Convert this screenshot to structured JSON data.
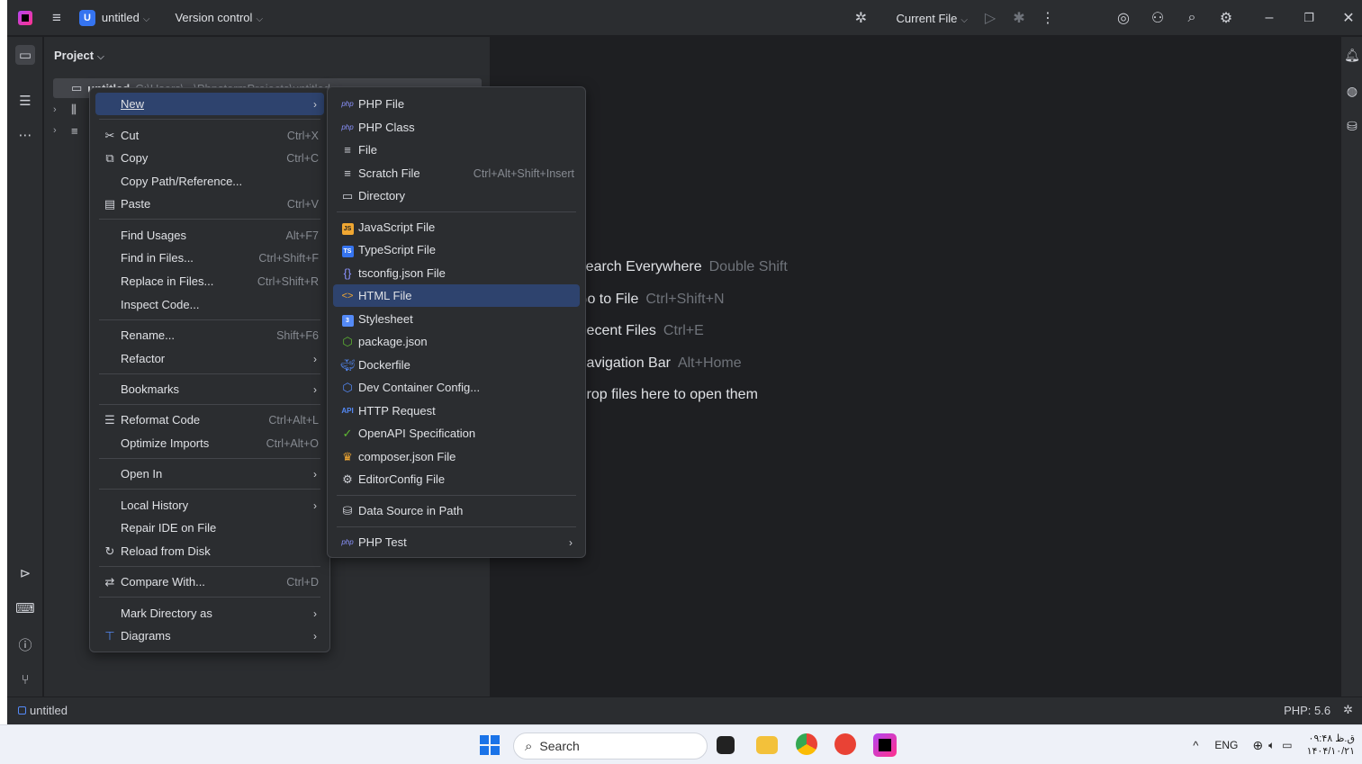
{
  "titlebar": {
    "project_badge": "U",
    "project_name": "untitled",
    "vcs_label": "Version control",
    "run_config": "Current File"
  },
  "panel": {
    "title": "Project",
    "tree_root": "untitled",
    "tree_root_path": "C:\\Users\\...\\PhpstormProjects\\untitled"
  },
  "context_menu": {
    "items": [
      {
        "label": "New",
        "icon": "",
        "shortcut": "",
        "submenu": true
      },
      {
        "label": "Cut",
        "icon": "scissors-icon",
        "shortcut": "Ctrl+X"
      },
      {
        "label": "Copy",
        "icon": "copy-icon",
        "shortcut": "Ctrl+C"
      },
      {
        "label": "Copy Path/Reference...",
        "icon": "",
        "shortcut": ""
      },
      {
        "label": "Paste",
        "icon": "paste-icon",
        "shortcut": "Ctrl+V"
      },
      {
        "label": "Find Usages",
        "icon": "",
        "shortcut": "Alt+F7"
      },
      {
        "label": "Find in Files...",
        "icon": "",
        "shortcut": "Ctrl+Shift+F"
      },
      {
        "label": "Replace in Files...",
        "icon": "",
        "shortcut": "Ctrl+Shift+R"
      },
      {
        "label": "Inspect Code...",
        "icon": "",
        "shortcut": ""
      },
      {
        "label": "Rename...",
        "icon": "",
        "shortcut": "Shift+F6"
      },
      {
        "label": "Refactor",
        "icon": "",
        "shortcut": "",
        "submenu": true
      },
      {
        "label": "Bookmarks",
        "icon": "",
        "shortcut": "",
        "submenu": true
      },
      {
        "label": "Reformat Code",
        "icon": "reformat-icon",
        "shortcut": "Ctrl+Alt+L"
      },
      {
        "label": "Optimize Imports",
        "icon": "",
        "shortcut": "Ctrl+Alt+O"
      },
      {
        "label": "Open In",
        "icon": "",
        "shortcut": "",
        "submenu": true
      },
      {
        "label": "Local History",
        "icon": "",
        "shortcut": "",
        "submenu": true
      },
      {
        "label": "Repair IDE on File",
        "icon": "",
        "shortcut": ""
      },
      {
        "label": "Reload from Disk",
        "icon": "reload-icon",
        "shortcut": ""
      },
      {
        "label": "Compare With...",
        "icon": "compare-icon",
        "shortcut": "Ctrl+D"
      },
      {
        "label": "Mark Directory as",
        "icon": "",
        "shortcut": "",
        "submenu": true
      },
      {
        "label": "Diagrams",
        "icon": "diagram-icon",
        "shortcut": "",
        "submenu": true
      }
    ]
  },
  "new_submenu": {
    "items": [
      {
        "label": "PHP File",
        "icon": "php-icon",
        "shortcut": ""
      },
      {
        "label": "PHP Class",
        "icon": "php-icon",
        "shortcut": ""
      },
      {
        "label": "File",
        "icon": "file-icon",
        "shortcut": ""
      },
      {
        "label": "Scratch File",
        "icon": "scratch-file-icon",
        "shortcut": "Ctrl+Alt+Shift+Insert"
      },
      {
        "label": "Directory",
        "icon": "folder-icon",
        "shortcut": ""
      },
      {
        "label": "JavaScript File",
        "icon": "javascript-icon",
        "shortcut": ""
      },
      {
        "label": "TypeScript File",
        "icon": "typescript-icon",
        "shortcut": ""
      },
      {
        "label": "tsconfig.json File",
        "icon": "tsconfig-icon",
        "shortcut": ""
      },
      {
        "label": "HTML File",
        "icon": "html-icon",
        "shortcut": ""
      },
      {
        "label": "Stylesheet",
        "icon": "css-icon",
        "shortcut": ""
      },
      {
        "label": "package.json",
        "icon": "nodejs-icon",
        "shortcut": ""
      },
      {
        "label": "Dockerfile",
        "icon": "docker-icon",
        "shortcut": ""
      },
      {
        "label": "Dev Container Config...",
        "icon": "container-icon",
        "shortcut": ""
      },
      {
        "label": "HTTP Request",
        "icon": "api-icon",
        "shortcut": ""
      },
      {
        "label": "OpenAPI Specification",
        "icon": "openapi-icon",
        "shortcut": ""
      },
      {
        "label": "composer.json File",
        "icon": "composer-icon",
        "shortcut": ""
      },
      {
        "label": "EditorConfig File",
        "icon": "gear-icon",
        "shortcut": ""
      },
      {
        "label": "Data Source in Path",
        "icon": "database-icon",
        "shortcut": ""
      },
      {
        "label": "PHP Test",
        "icon": "php-test-icon",
        "shortcut": "",
        "submenu": true
      }
    ]
  },
  "editor_hints": [
    {
      "label": "Search Everywhere",
      "key": "Double Shift"
    },
    {
      "label": "Go to File",
      "key": "Ctrl+Shift+N"
    },
    {
      "label": "Recent Files",
      "key": "Ctrl+E"
    },
    {
      "label": "Navigation Bar",
      "key": "Alt+Home"
    },
    {
      "label": "Drop files here to open them",
      "key": ""
    }
  ],
  "statusbar": {
    "project": "untitled",
    "php_version": "PHP: 5.6"
  },
  "taskbar": {
    "search_placeholder": "Search",
    "language": "ENG",
    "time": "۰۹:۴۸ ق.ظ",
    "date": "۱۴۰۴/۱۰/۲۱"
  },
  "colors": {
    "highlight": "#2e436e",
    "accent": "#3574f0",
    "menu_bg": "#2b2d30"
  }
}
